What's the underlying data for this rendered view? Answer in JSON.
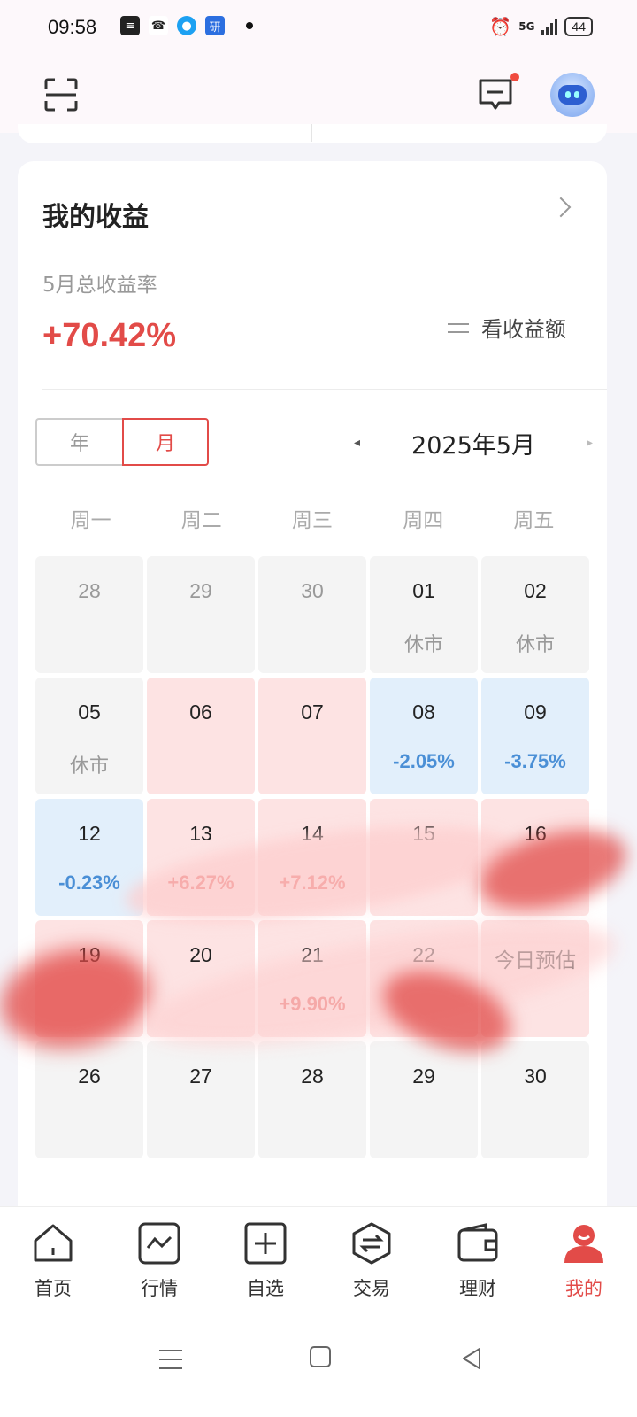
{
  "status_bar": {
    "time": "09:58",
    "left_icons": [
      "news-icon",
      "call-icon",
      "qq-icon",
      "yan-app-icon"
    ],
    "yan_app_char": "研",
    "network": "5G",
    "battery": "44"
  },
  "header": {
    "icons": [
      "scan-icon",
      "message-icon",
      "robot-assistant-icon"
    ],
    "notification_color": "#f04b3f"
  },
  "earnings": {
    "title": "我的收益",
    "period_label": "5月总收益率",
    "total_rate": "+70.42%",
    "toggle_label": "看收益额",
    "accent_color": "#e24b48",
    "loss_color": "#4a8fd6"
  },
  "calendar": {
    "segments": [
      "年",
      "月"
    ],
    "selected_segment": "月",
    "prev_arrow": "◂",
    "next_arrow": "▸",
    "month_label": "2025年5月",
    "weekdays": [
      "周一",
      "周二",
      "周三",
      "周四",
      "周五"
    ],
    "cells": [
      {
        "day": "28",
        "value": "",
        "state": "other-month"
      },
      {
        "day": "29",
        "value": "",
        "state": "other-month"
      },
      {
        "day": "30",
        "value": "",
        "state": "other-month"
      },
      {
        "day": "01",
        "value": "休市",
        "state": "closed"
      },
      {
        "day": "02",
        "value": "休市",
        "state": "closed"
      },
      {
        "day": "05",
        "value": "休市",
        "state": "closed"
      },
      {
        "day": "06",
        "value": "",
        "state": "gain"
      },
      {
        "day": "07",
        "value": "",
        "state": "gain"
      },
      {
        "day": "08",
        "value": "-2.05%",
        "state": "loss"
      },
      {
        "day": "09",
        "value": "-3.75%",
        "state": "loss"
      },
      {
        "day": "12",
        "value": "-0.23%",
        "state": "loss"
      },
      {
        "day": "13",
        "value": "+6.27%",
        "state": "gain"
      },
      {
        "day": "14",
        "value": "+7.12%",
        "state": "gain"
      },
      {
        "day": "15",
        "value": "",
        "state": "gain"
      },
      {
        "day": "16",
        "value": "",
        "state": "gain"
      },
      {
        "day": "19",
        "value": "",
        "state": "gain"
      },
      {
        "day": "20",
        "value": "",
        "state": "gain"
      },
      {
        "day": "21",
        "value": "+9.90%",
        "state": "gain"
      },
      {
        "day": "22",
        "value": "",
        "state": "gain"
      },
      {
        "day": "",
        "value": "",
        "state": "today",
        "label": "今日预估"
      },
      {
        "day": "26",
        "value": "",
        "state": "future"
      },
      {
        "day": "27",
        "value": "",
        "state": "future"
      },
      {
        "day": "28",
        "value": "",
        "state": "future"
      },
      {
        "day": "29",
        "value": "",
        "state": "future"
      },
      {
        "day": "30",
        "value": "",
        "state": "future"
      }
    ]
  },
  "tab_bar": {
    "items": [
      {
        "label": "首页",
        "icon": "home-icon"
      },
      {
        "label": "行情",
        "icon": "market-chart-icon"
      },
      {
        "label": "自选",
        "icon": "add-watchlist-icon"
      },
      {
        "label": "交易",
        "icon": "trade-exchange-icon"
      },
      {
        "label": "理财",
        "icon": "wallet-icon"
      },
      {
        "label": "我的",
        "icon": "profile-icon"
      }
    ],
    "active": "我的"
  }
}
